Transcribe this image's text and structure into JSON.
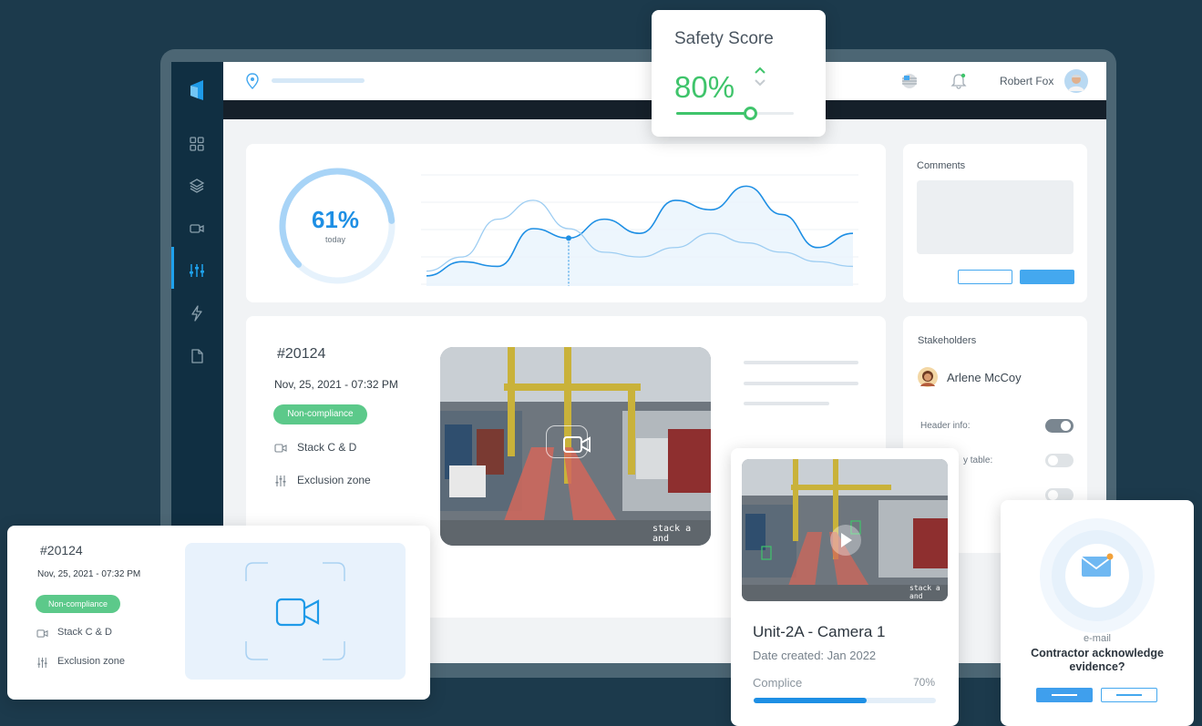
{
  "header": {
    "user_name": "Robert Fox",
    "icons": [
      "location-pin-icon",
      "flag-icon",
      "bell-icon",
      "avatar"
    ]
  },
  "sidebar": {
    "items": [
      {
        "icon": "grid-icon"
      },
      {
        "icon": "layers-icon"
      },
      {
        "icon": "video-camera-icon"
      },
      {
        "icon": "sliders-icon",
        "active": true
      },
      {
        "icon": "lightning-icon"
      },
      {
        "icon": "document-icon"
      }
    ]
  },
  "overview": {
    "percent": "61%",
    "percent_sub": "today"
  },
  "chart_data": {
    "type": "line",
    "series": [
      {
        "values": [
          2,
          8,
          6,
          22,
          18,
          26,
          20,
          34,
          30,
          40,
          28,
          14,
          20
        ]
      },
      {
        "values": [
          4,
          10,
          26,
          34,
          22,
          12,
          10,
          14,
          20,
          16,
          12,
          8,
          6
        ]
      }
    ],
    "highlight_index": 4,
    "grid": true
  },
  "comments": {
    "title": "Comments"
  },
  "event": {
    "id": "#20124",
    "datetime": "Nov, 25, 2021 - 07:32 PM",
    "status": "Non-compliance",
    "camera": "Stack C & D",
    "zone": "Exclusion zone",
    "video_caption": "stack a and"
  },
  "stakeholders": {
    "title": "Stakeholders",
    "person": "Arlene McCoy",
    "toggle1_label": "Header info:",
    "toggle2_label": "y table:",
    "toggles": [
      true,
      false,
      false
    ]
  },
  "safety": {
    "title": "Safety Score",
    "value": "80%",
    "level": 0.63
  },
  "incident": {
    "id": "#20124",
    "datetime": "Nov, 25, 2021 - 07:32 PM",
    "status": "Non-compliance",
    "camera": "Stack C & D",
    "zone": "Exclusion zone"
  },
  "camera_card": {
    "title": "Unit-2A - Camera 1",
    "date": "Date created: Jan 2022",
    "progress_label": "Complice",
    "progress_value": "70%",
    "progress": 0.62,
    "video_caption": "stack a and"
  },
  "email_card": {
    "label": "e-mail",
    "question": "Contractor acknowledge evidence?"
  },
  "colors": {
    "accent_blue": "#1e8fe4",
    "green": "#3fc46b",
    "badge_green": "#5cc98a",
    "background": "#1c3a4c",
    "sidebar": "#102f42"
  }
}
